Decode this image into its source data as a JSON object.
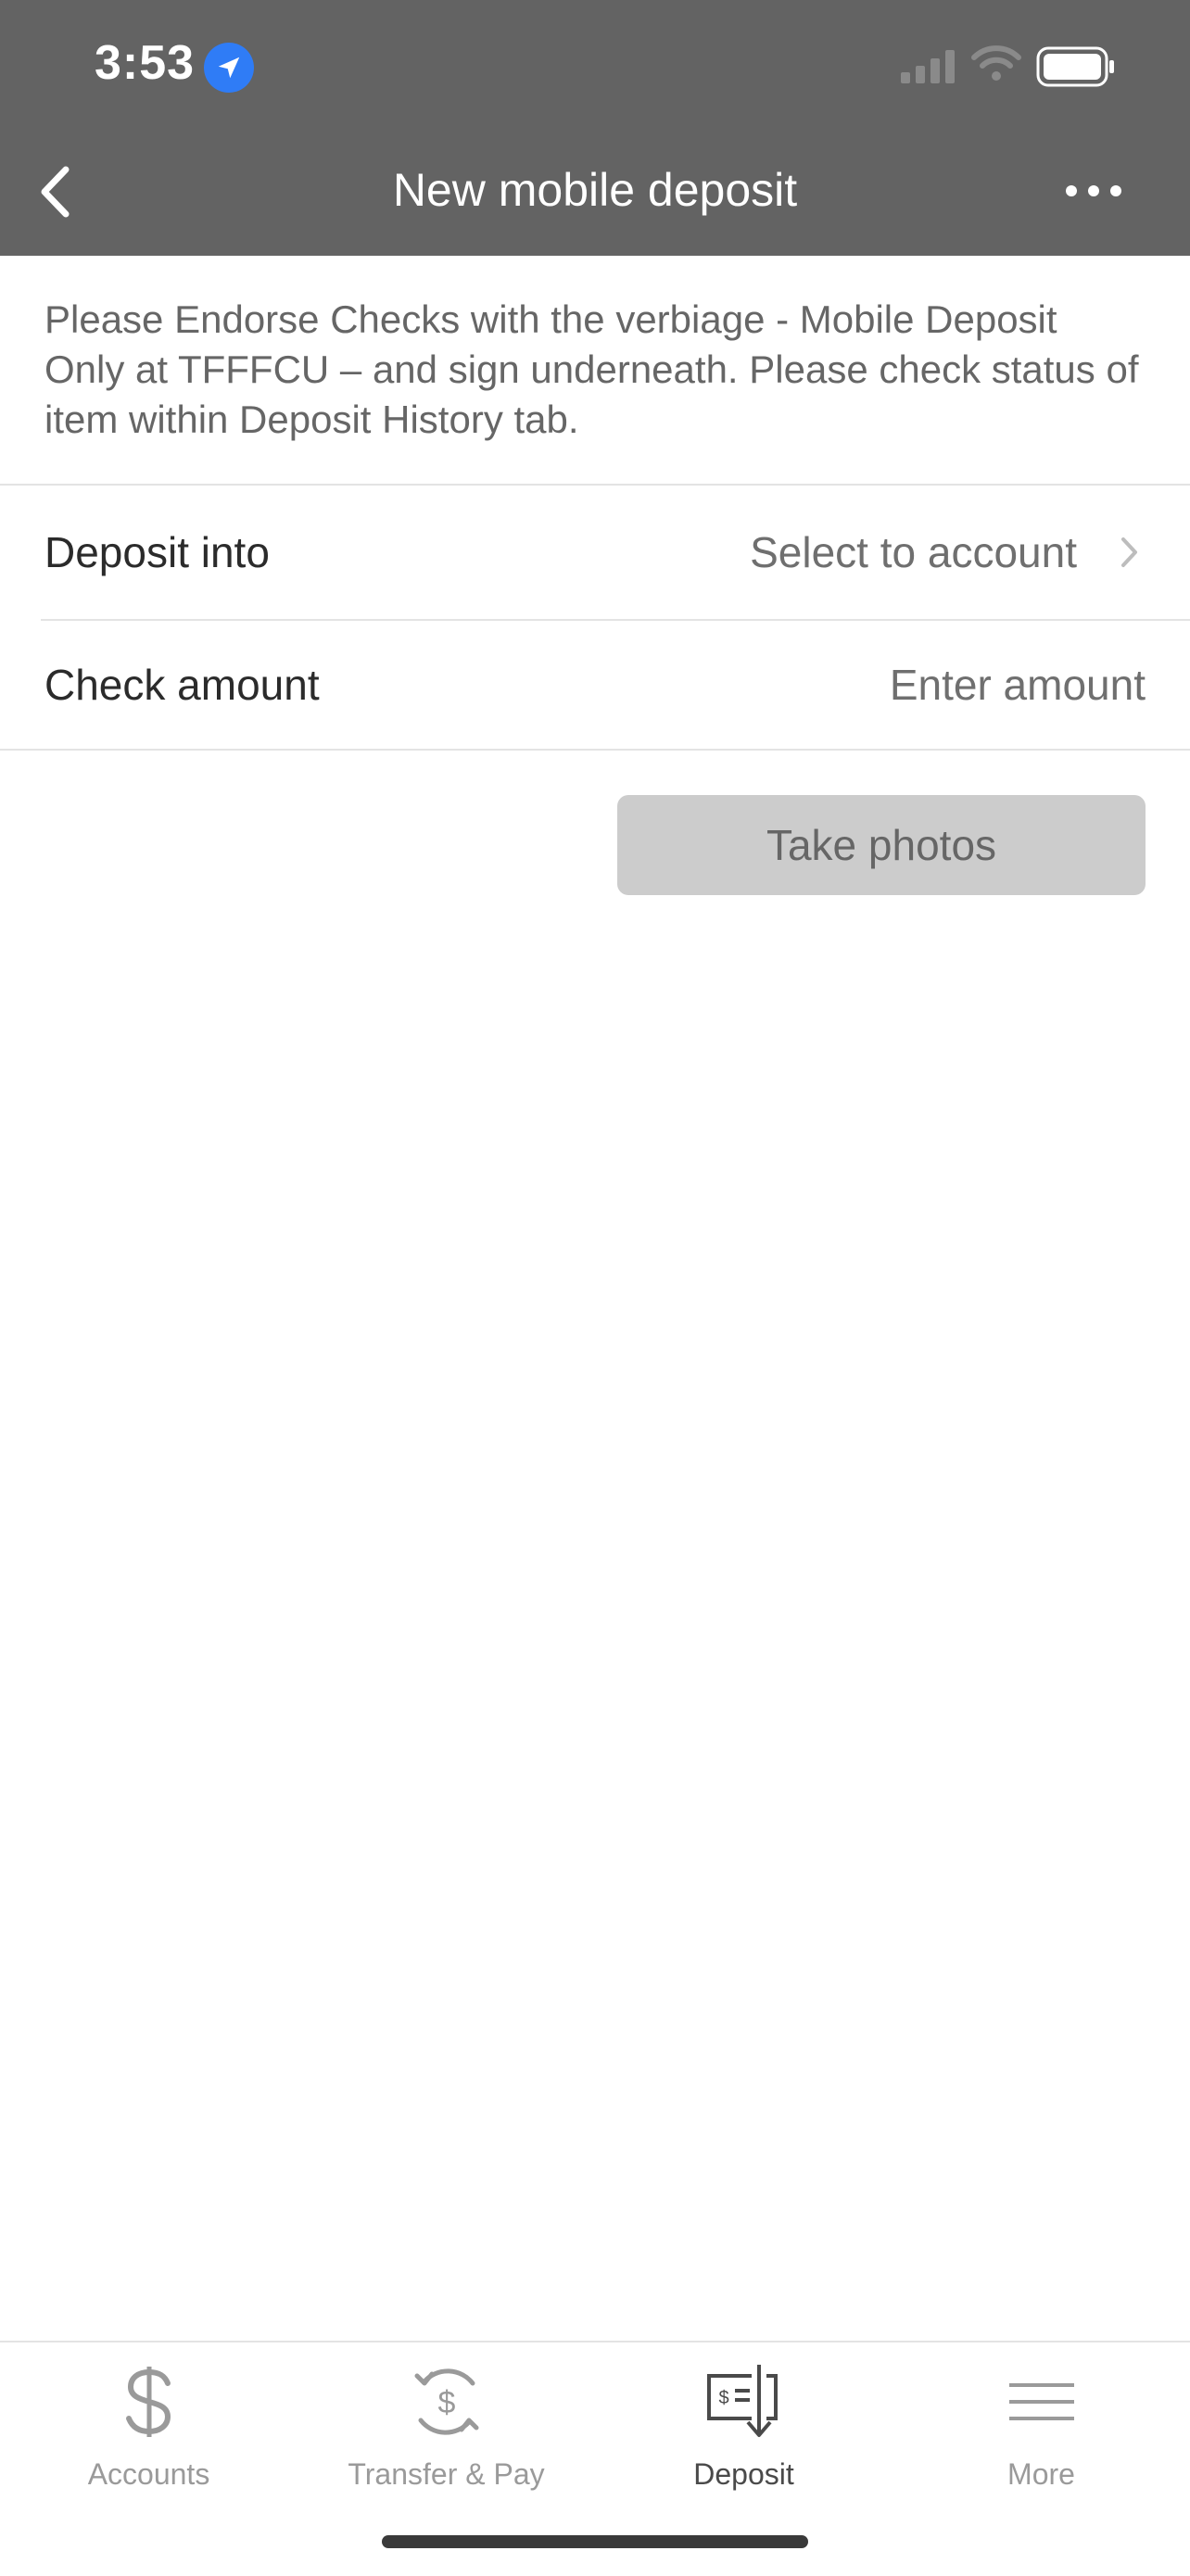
{
  "status_bar": {
    "time": "3:53"
  },
  "nav": {
    "title": "New mobile deposit"
  },
  "notice": {
    "text": "Please Endorse Checks with the verbiage - Mobile Deposit Only at TFFFCU – and sign underneath. Please check status of item within Deposit History tab."
  },
  "form": {
    "deposit_into": {
      "label": "Deposit into",
      "value": "Select to account"
    },
    "check_amount": {
      "label": "Check amount",
      "placeholder": "Enter amount"
    }
  },
  "actions": {
    "take_photos": "Take photos"
  },
  "tabs": [
    {
      "label": "Accounts",
      "icon": "dollar-icon",
      "active": false
    },
    {
      "label": "Transfer & Pay",
      "icon": "transfer-dollar-icon",
      "active": false
    },
    {
      "label": "Deposit",
      "icon": "check-deposit-icon",
      "active": true
    },
    {
      "label": "More",
      "icon": "menu-icon",
      "active": false
    }
  ],
  "colors": {
    "header": "#636363",
    "accent": "#2f7cf6",
    "button_disabled": "#cccccc"
  }
}
